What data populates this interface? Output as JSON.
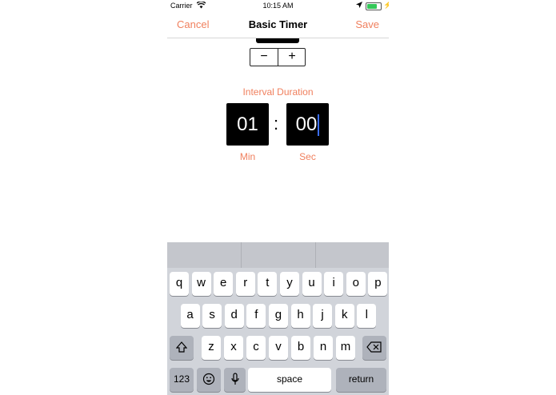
{
  "status_bar": {
    "carrier": "Carrier",
    "time": "10:15 AM",
    "battery_level": 0.75
  },
  "nav": {
    "cancel": "Cancel",
    "title": "Basic Timer",
    "save": "Save"
  },
  "stepper": {
    "minus": "−",
    "plus": "+"
  },
  "interval": {
    "label": "Interval Duration",
    "minutes": "01",
    "seconds": "00",
    "separator": ":",
    "min_label": "Min",
    "sec_label": "Sec"
  },
  "keyboard": {
    "row1": [
      "q",
      "w",
      "e",
      "r",
      "t",
      "y",
      "u",
      "i",
      "o",
      "p"
    ],
    "row2": [
      "a",
      "s",
      "d",
      "f",
      "g",
      "h",
      "j",
      "k",
      "l"
    ],
    "row3": [
      "z",
      "x",
      "c",
      "v",
      "b",
      "n",
      "m"
    ],
    "numbers_key": "123",
    "space_key": "space",
    "return_key": "return"
  },
  "colors": {
    "accent": "#f0805e",
    "battery": "#35c759",
    "cursor": "#3b6fff"
  }
}
